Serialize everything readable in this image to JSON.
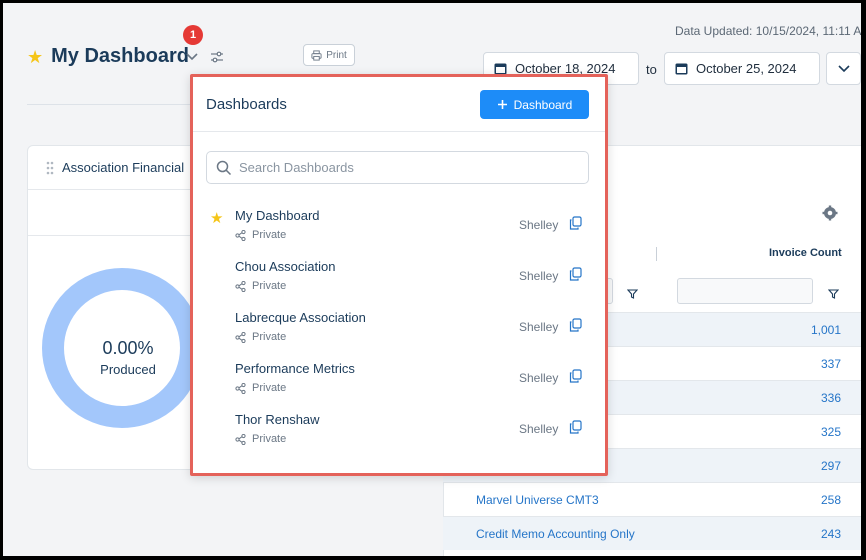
{
  "header": {
    "title": "My Dashboard",
    "notification_count": "1",
    "print_label": "Print",
    "data_updated": "Data Updated: 10/15/2024, 11:11 AM",
    "date_from": "October 18, 2024",
    "date_to": "October 25, 2024",
    "to_label": "to"
  },
  "left_card": {
    "title": "Association Financial",
    "percent": "0.00%",
    "caption": "Produced"
  },
  "right_card": {
    "column_header": "Invoice Count",
    "rows": [
      {
        "name": "",
        "count": "1,001"
      },
      {
        "name": "",
        "count": "337"
      },
      {
        "name": "",
        "count": "336"
      },
      {
        "name": "",
        "count": "325"
      },
      {
        "name": "",
        "count": "297"
      },
      {
        "name": "Marvel Universe CMT3",
        "count": "258"
      },
      {
        "name": "Credit Memo Accounting Only",
        "count": "243"
      }
    ]
  },
  "dashboards_popup": {
    "title": "Dashboards",
    "add_button": "Dashboard",
    "search_placeholder": "Search Dashboards",
    "items": [
      {
        "name": "My Dashboard",
        "visibility": "Private",
        "owner": "Shelley",
        "starred": true
      },
      {
        "name": "Chou Association",
        "visibility": "Private",
        "owner": "Shelley",
        "starred": false
      },
      {
        "name": "Labrecque Association",
        "visibility": "Private",
        "owner": "Shelley",
        "starred": false
      },
      {
        "name": "Performance Metrics",
        "visibility": "Private",
        "owner": "Shelley",
        "starred": false
      },
      {
        "name": "Thor Renshaw",
        "visibility": "Private",
        "owner": "Shelley",
        "starred": false
      }
    ]
  },
  "colors": {
    "accent": "#1d8cf8",
    "star": "#f5c518",
    "badge": "#e53935",
    "donut": "#a3c7fb",
    "highlight_border": "#e4625a"
  }
}
